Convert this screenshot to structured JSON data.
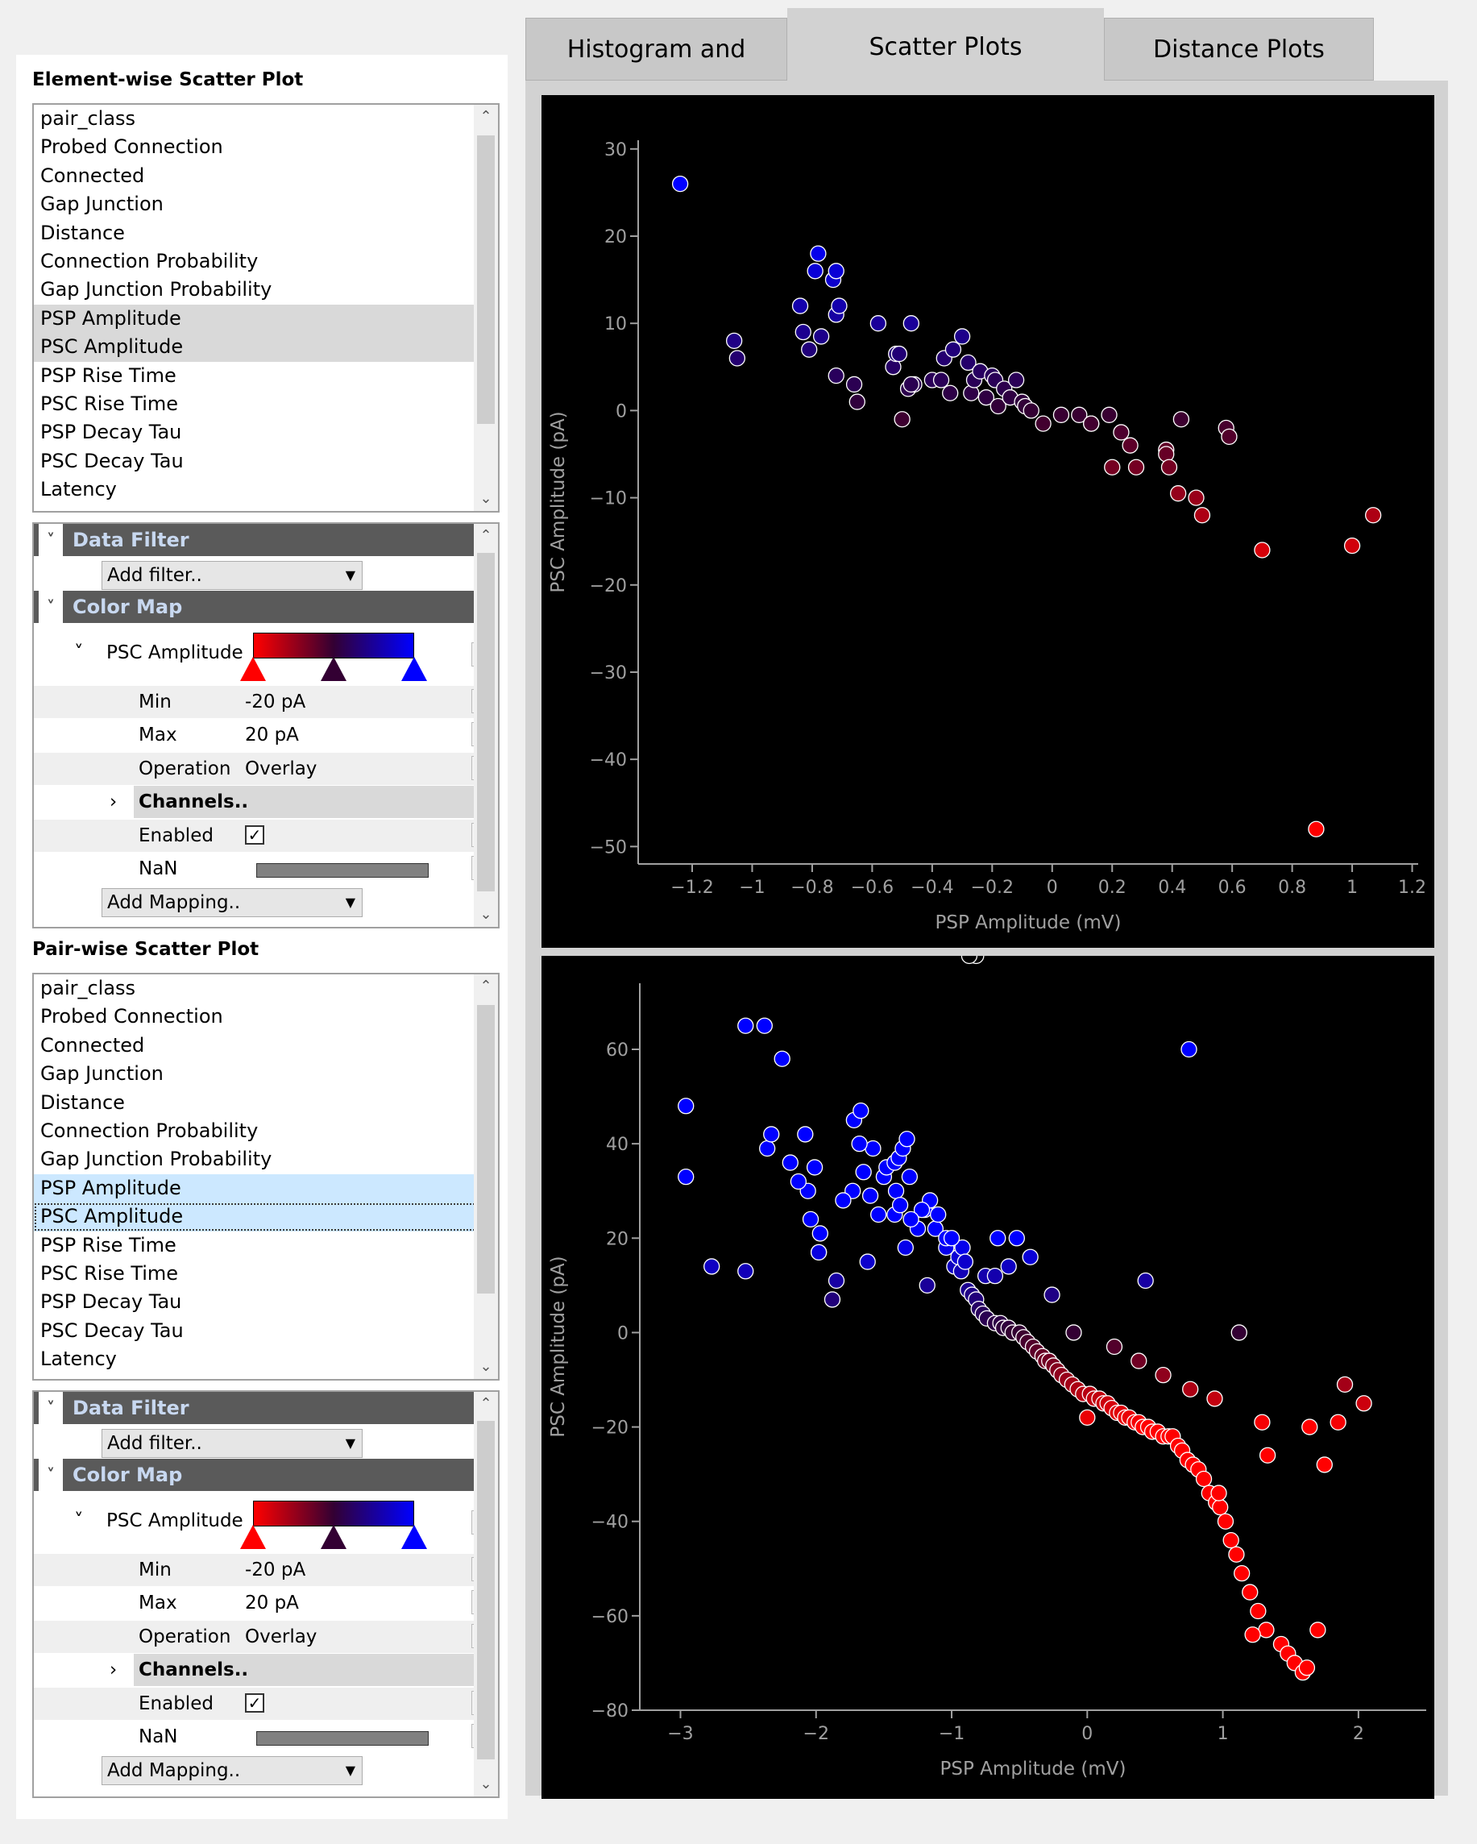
{
  "tabs": [
    {
      "label": "Histogram and TSeries",
      "active": false
    },
    {
      "label": "Scatter Plots",
      "active": true
    },
    {
      "label": "Distance Plots",
      "active": false
    }
  ],
  "element_panel": {
    "title": "Element-wise Scatter Plot",
    "fields": [
      "pair_class",
      "Probed Connection",
      "Connected",
      "Gap Junction",
      "Distance",
      "Connection Probability",
      "Gap Junction Probability",
      "PSP Amplitude",
      "PSC Amplitude",
      "PSP Rise Time",
      "PSC Rise Time",
      "PSP Decay Tau",
      "PSC Decay Tau",
      "Latency"
    ],
    "data_filter": "Data Filter",
    "add_filter": "Add filter..",
    "color_map": "Color Map",
    "cmap_field": "PSC Amplitude",
    "min_label": "Min",
    "min_value": "-20 pA",
    "max_label": "Max",
    "max_value": "20 pA",
    "operation_label": "Operation",
    "operation_value": "Overlay",
    "channels_label": "Channels..",
    "enabled_label": "Enabled",
    "enabled_checked": true,
    "nan_label": "NaN",
    "nan_color": "#808080",
    "add_mapping": "Add Mapping..",
    "cmap_colors": [
      "#ff0000",
      "#330033",
      "#0000ff"
    ]
  },
  "pair_panel": {
    "title": "Pair-wise Scatter Plot",
    "fields": [
      "pair_class",
      "Probed Connection",
      "Connected",
      "Gap Junction",
      "Distance",
      "Connection Probability",
      "Gap Junction Probability",
      "PSP Amplitude",
      "PSC Amplitude",
      "PSP Rise Time",
      "PSC Rise Time",
      "PSP Decay Tau",
      "PSC Decay Tau",
      "Latency"
    ],
    "data_filter": "Data Filter",
    "add_filter": "Add filter..",
    "color_map": "Color Map",
    "cmap_field": "PSC Amplitude",
    "min_label": "Min",
    "min_value": "-20 pA",
    "max_label": "Max",
    "max_value": "20 pA",
    "operation_label": "Operation",
    "operation_value": "Overlay",
    "channels_label": "Channels..",
    "enabled_label": "Enabled",
    "enabled_checked": true,
    "nan_label": "NaN",
    "nan_color": "#808080",
    "add_mapping": "Add Mapping..",
    "cmap_colors": [
      "#ff0000",
      "#330033",
      "#0000ff"
    ]
  },
  "chart_data": [
    {
      "type": "scatter",
      "xlabel": "PSP Amplitude (mV)",
      "ylabel": "PSC Amplitude (pA)",
      "xlim": [
        -1.38,
        1.22
      ],
      "ylim": [
        -52,
        31
      ],
      "xticks": [
        -1.2,
        -1,
        -0.8,
        -0.6,
        -0.4,
        -0.2,
        0,
        0.2,
        0.4,
        0.6,
        0.8,
        1,
        1.2
      ],
      "yticks": [
        30,
        20,
        10,
        0,
        -10,
        -20,
        -30,
        -40,
        -50
      ],
      "x": [
        -1.24,
        -1.06,
        -1.05,
        -0.84,
        -0.83,
        -0.81,
        -0.79,
        -0.78,
        -0.77,
        -0.73,
        -0.72,
        -0.72,
        -0.71,
        -0.72,
        -0.66,
        -0.65,
        -0.58,
        -0.53,
        -0.52,
        -0.51,
        -0.5,
        -0.48,
        -0.47,
        -0.46,
        -0.47,
        -0.4,
        -0.37,
        -0.36,
        -0.34,
        -0.33,
        -0.3,
        -0.28,
        -0.27,
        -0.26,
        -0.24,
        -0.22,
        -0.2,
        -0.19,
        -0.18,
        -0.16,
        -0.14,
        -0.12,
        -0.1,
        -0.09,
        -0.07,
        -0.03,
        0.03,
        0.09,
        0.13,
        0.13,
        0.19,
        0.23,
        0.26,
        0.2,
        0.28,
        0.38,
        0.38,
        0.39,
        0.43,
        0.42,
        0.48,
        0.5,
        0.58,
        0.59,
        0.7,
        1.0,
        1.07,
        0.88
      ],
      "y": [
        26,
        8,
        6,
        12,
        9,
        7,
        16,
        18,
        8.5,
        15,
        16,
        11,
        12,
        4,
        3,
        1,
        10,
        5,
        6.5,
        6.5,
        -1,
        2.5,
        10,
        3,
        3,
        3.5,
        3.5,
        6,
        2,
        7,
        8.5,
        5.5,
        2,
        3.5,
        4.5,
        1.5,
        4,
        3.5,
        0.5,
        2.5,
        1.5,
        3.5,
        1,
        0.5,
        0,
        -1.5,
        -0.5,
        -0.5,
        -1.5,
        -1.5,
        -0.5,
        -2.5,
        -4,
        -6.5,
        -6.5,
        -4.5,
        -5,
        -6.5,
        -1,
        -9.5,
        -10,
        -12,
        -2,
        -3,
        -16,
        -15.5,
        -12,
        -48
      ]
    },
    {
      "type": "scatter",
      "xlabel": "PSP Amplitude (mV)",
      "ylabel": "PSC Amplitude (pA)",
      "xlim": [
        -3.3,
        2.5
      ],
      "ylim": [
        -80,
        74
      ],
      "xticks": [
        -3,
        -2,
        -1,
        0,
        1,
        2
      ],
      "yticks": [
        60,
        40,
        20,
        0,
        -20,
        -40,
        -60,
        -80
      ],
      "x": [
        -2.96,
        -2.96,
        -2.77,
        -2.52,
        -2.52,
        -2.38,
        -2.25,
        -2.36,
        -2.33,
        -2.19,
        -2.08,
        -2.06,
        -2.04,
        -2.13,
        -2.01,
        -1.98,
        -1.98,
        -1.97,
        -1.85,
        -1.88,
        -1.72,
        -1.67,
        -1.65,
        -1.58,
        -1.6,
        -1.68,
        -1.5,
        -1.42,
        -1.41,
        -1.48,
        -1.42,
        -1.39,
        -1.36,
        -1.33,
        -1.31,
        -1.25,
        -1.2,
        -1.16,
        -1.12,
        -1.04,
        -0.98,
        -0.95,
        -0.93,
        -0.88,
        -0.85,
        -0.82,
        -0.8,
        -0.77,
        -0.74,
        -0.68,
        -0.64,
        -0.62,
        -0.58,
        -0.55,
        -0.5,
        -0.47,
        -0.44,
        -0.4,
        -0.37,
        -0.33,
        -0.31,
        -0.28,
        -0.25,
        -0.22,
        -0.19,
        -0.15,
        -0.11,
        -0.07,
        -0.03,
        0.02,
        0.05,
        0.09,
        0.12,
        0.15,
        0.18,
        0.22,
        0.25,
        0.28,
        0.31,
        0.35,
        0.38,
        0.41,
        0.45,
        0.48,
        0.52,
        0.56,
        0.6,
        0.63,
        0.67,
        0.7,
        0.74,
        0.78,
        0.82,
        0.86,
        0.9,
        0.95,
        0.98,
        1.02,
        1.06,
        1.1,
        1.14,
        1.2,
        1.26,
        1.32,
        1.43,
        1.48,
        1.53,
        1.59,
        1.62,
        1.7,
        1.75,
        1.9,
        2.04,
        1.85,
        1.64,
        1.22,
        1.33,
        0.97,
        0.75,
        0.43,
        -1.22,
        -1.38,
        -1.3,
        -1.04,
        -0.92,
        -0.75,
        -0.58,
        -0.42,
        -0.26,
        -0.1,
        0.2,
        0.38,
        0.56,
        0.76,
        0.94,
        1.12,
        1.29,
        0.0,
        -0.52,
        -0.66,
        -0.9,
        -1.0,
        -1.1,
        -1.54,
        -1.73,
        -1.8,
        -1.34,
        -1.62,
        -1.18,
        -0.68,
        -0.82,
        -0.87
      ],
      "y": [
        48,
        33,
        14,
        65,
        13,
        65,
        58,
        39,
        42,
        36,
        42,
        30,
        24,
        32,
        35,
        17,
        17,
        21,
        11,
        7,
        45,
        47,
        34,
        39,
        29,
        40,
        33,
        25,
        30,
        35,
        36,
        37,
        39,
        41,
        33,
        22,
        26,
        28,
        22,
        18,
        14,
        16,
        13,
        9,
        8,
        7,
        5,
        4,
        3,
        2,
        2,
        1,
        1,
        0,
        0,
        -1,
        -2,
        -3,
        -4,
        -5,
        -6,
        -6,
        -7,
        -8,
        -9,
        -10,
        -11,
        -12,
        -13,
        -13,
        -14,
        -14,
        -15,
        -15,
        -16,
        -17,
        -17,
        -18,
        -18,
        -19,
        -19,
        -20,
        -20,
        -21,
        -21,
        -22,
        -22,
        -22,
        -24,
        -25,
        -27,
        -28,
        -29,
        -31,
        -34,
        -36,
        -37,
        -40,
        -44,
        -47,
        -51,
        -55,
        -59,
        -63,
        -66,
        -68,
        -70,
        -72,
        -71,
        -63,
        -28,
        -11,
        -15,
        -19,
        -20,
        -64,
        -26,
        -34,
        60,
        11,
        26,
        27,
        24,
        20,
        18,
        12,
        14,
        16,
        8,
        0,
        -3,
        -6,
        -9,
        -12,
        -14,
        0,
        -19,
        -18,
        20,
        20,
        15,
        20,
        25,
        25,
        30,
        28,
        18,
        15,
        10,
        12
      ],
      "_point_count_note": ""
    }
  ]
}
